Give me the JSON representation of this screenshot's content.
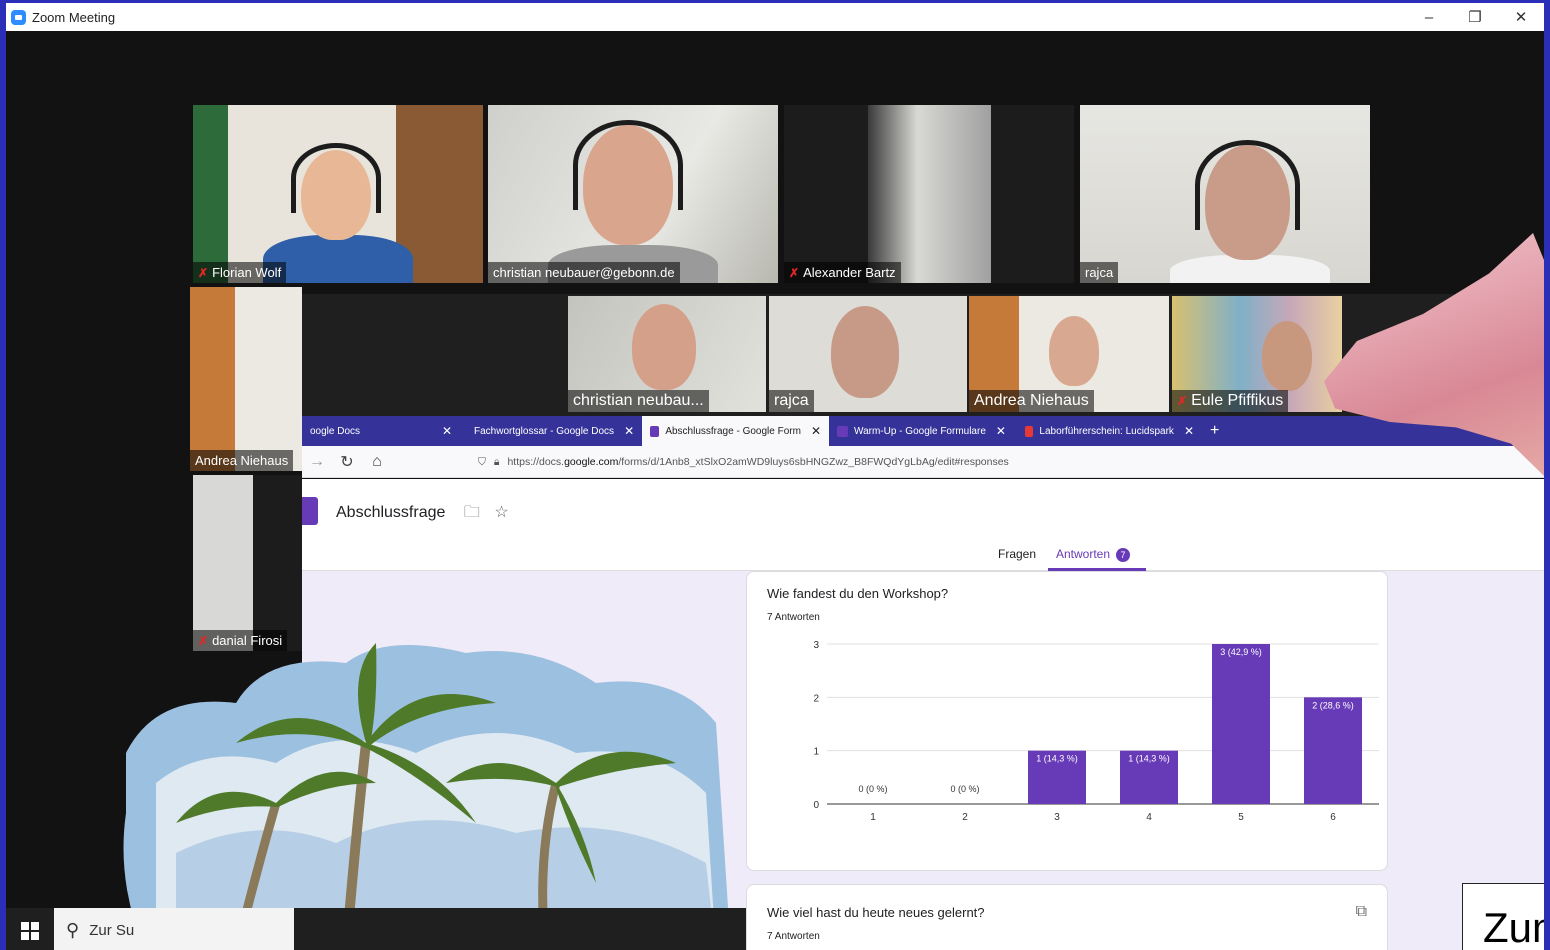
{
  "window": {
    "title": "Zoom Meeting",
    "minimize": "–",
    "restore": "❐",
    "close": "✕"
  },
  "participants_top": [
    {
      "name": "Florian Wolf",
      "muted": true
    },
    {
      "name": "christian neubauer@gebonn.de",
      "muted": false
    },
    {
      "name": "Alexander Bartz",
      "muted": true
    },
    {
      "name": "rajca",
      "muted": false
    }
  ],
  "participants_side": [
    {
      "name": "Andrea Niehaus",
      "muted": false
    },
    {
      "name": "danial Firosi",
      "muted": true
    }
  ],
  "participants_strip": [
    {
      "name": "christian neubau...",
      "muted": false
    },
    {
      "name": "rajca",
      "muted": false
    },
    {
      "name": "Andrea Niehaus",
      "muted": false
    },
    {
      "name": "Eule Pfiffikus",
      "muted": true
    }
  ],
  "browser": {
    "tabs": [
      {
        "label": "oogle Docs",
        "color": "#4285f4"
      },
      {
        "label": "Fachwortglossar - Google Docs",
        "color": "#4285f4"
      },
      {
        "label": "Abschlussfrage - Google Form",
        "color": "#673ab7"
      },
      {
        "label": "Warm-Up - Google Formulare",
        "color": "#673ab7"
      },
      {
        "label": "Laborführerschein: Lucidspark",
        "color": "#e53935"
      }
    ],
    "new_tab": "+",
    "url_prefix": "https://docs.",
    "url_domain": "google.com",
    "url_suffix": "/forms/d/1Anb8_xtSlxO2amWD9luys6sbHNGZwz_B8FWQdYgLbAg/edit#responses"
  },
  "form": {
    "title": "Abschlussfrage",
    "tab_questions": "Fragen",
    "tab_answers": "Antworten",
    "answers_count": "7",
    "q1": {
      "title": "Wie fandest du den Workshop?",
      "count": "7 Antworten"
    },
    "q2": {
      "title": "Wie viel hast du heute neues gelernt?",
      "count": "7 Antworten"
    }
  },
  "chart_data": {
    "type": "bar",
    "categories": [
      "1",
      "2",
      "3",
      "4",
      "5",
      "6"
    ],
    "values": [
      0,
      0,
      1,
      1,
      3,
      2
    ],
    "labels": [
      "0 (0 %)",
      "0 (0 %)",
      "1 (14,3 %)",
      "1 (14,3 %)",
      "3 (42,9 %)",
      "2 (28,6 %)"
    ],
    "yticks": [
      "0",
      "1",
      "2",
      "3"
    ],
    "ylim": [
      0,
      3
    ],
    "color": "#673ab7"
  },
  "taskbar": {
    "search_text": "Zur Su"
  },
  "overlay_text": "Zum"
}
